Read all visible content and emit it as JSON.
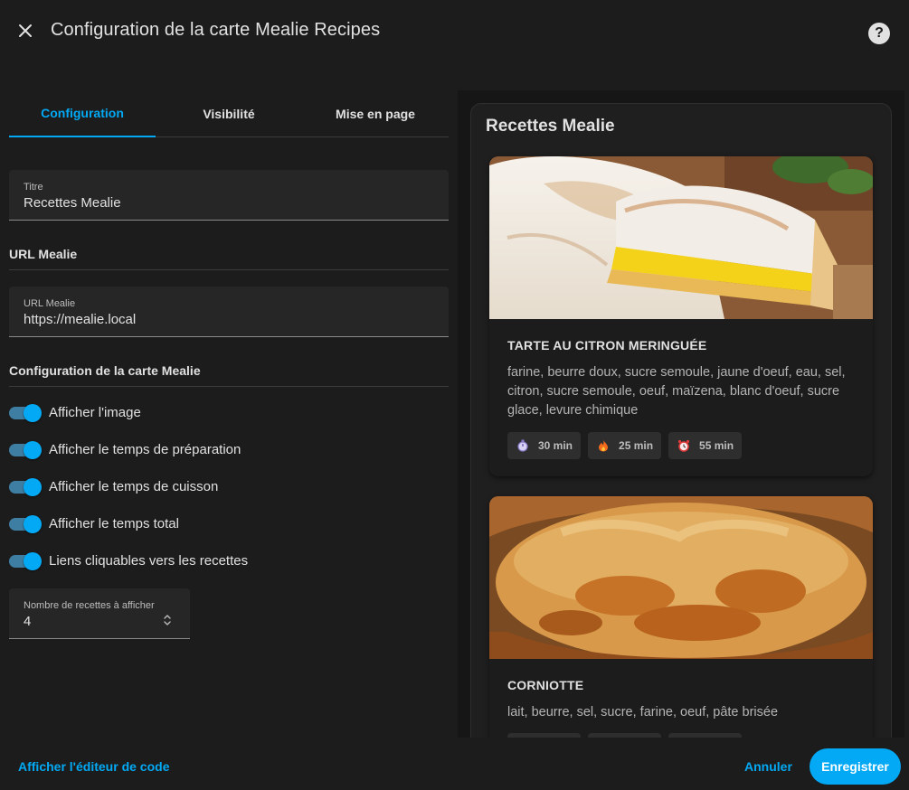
{
  "dialog": {
    "title": "Configuration de la carte Mealie Recipes",
    "close_icon": "close-icon",
    "help_icon": "help-icon"
  },
  "tabs": [
    {
      "label": "Configuration",
      "active": true
    },
    {
      "label": "Visibilité",
      "active": false
    },
    {
      "label": "Mise en page",
      "active": false
    }
  ],
  "fields": {
    "title": {
      "label": "Titre",
      "value": "Recettes Mealie"
    },
    "url_section": "URL Mealie",
    "url": {
      "label": "URL Mealie",
      "value": "https://mealie.local"
    },
    "card_section": "Configuration de la carte Mealie",
    "count": {
      "label": "Nombre de recettes à afficher",
      "value": "4"
    }
  },
  "switches": [
    {
      "label": "Afficher l'image",
      "on": true
    },
    {
      "label": "Afficher le temps de préparation",
      "on": true
    },
    {
      "label": "Afficher le temps de cuisson",
      "on": true
    },
    {
      "label": "Afficher le temps total",
      "on": true
    },
    {
      "label": "Liens cliquables vers les recettes",
      "on": true
    }
  ],
  "preview": {
    "card_title": "Recettes Mealie",
    "recipes": [
      {
        "name": "TARTE AU CITRON MERINGUÉE",
        "ingredients": "farine, beurre doux, sucre semoule, jaune d'oeuf, eau, sel, citron, sucre semoule, oeuf, maïzena, blanc d'oeuf, sucre glace, levure chimique",
        "times": [
          {
            "icon": "timer-icon",
            "label": "30 min"
          },
          {
            "icon": "fire-icon",
            "label": "25 min"
          },
          {
            "icon": "alarm-clock-icon",
            "label": "55 min"
          }
        ]
      },
      {
        "name": "CORNIOTTE",
        "ingredients": "lait, beurre, sel, sucre, farine, oeuf, pâte brisée"
      }
    ]
  },
  "footer": {
    "code_editor": "Afficher l'éditeur de code",
    "cancel": "Annuler",
    "save": "Enregistrer"
  },
  "colors": {
    "accent": "#03a9f4",
    "background": "#1c1c1c",
    "field": "#262626"
  }
}
